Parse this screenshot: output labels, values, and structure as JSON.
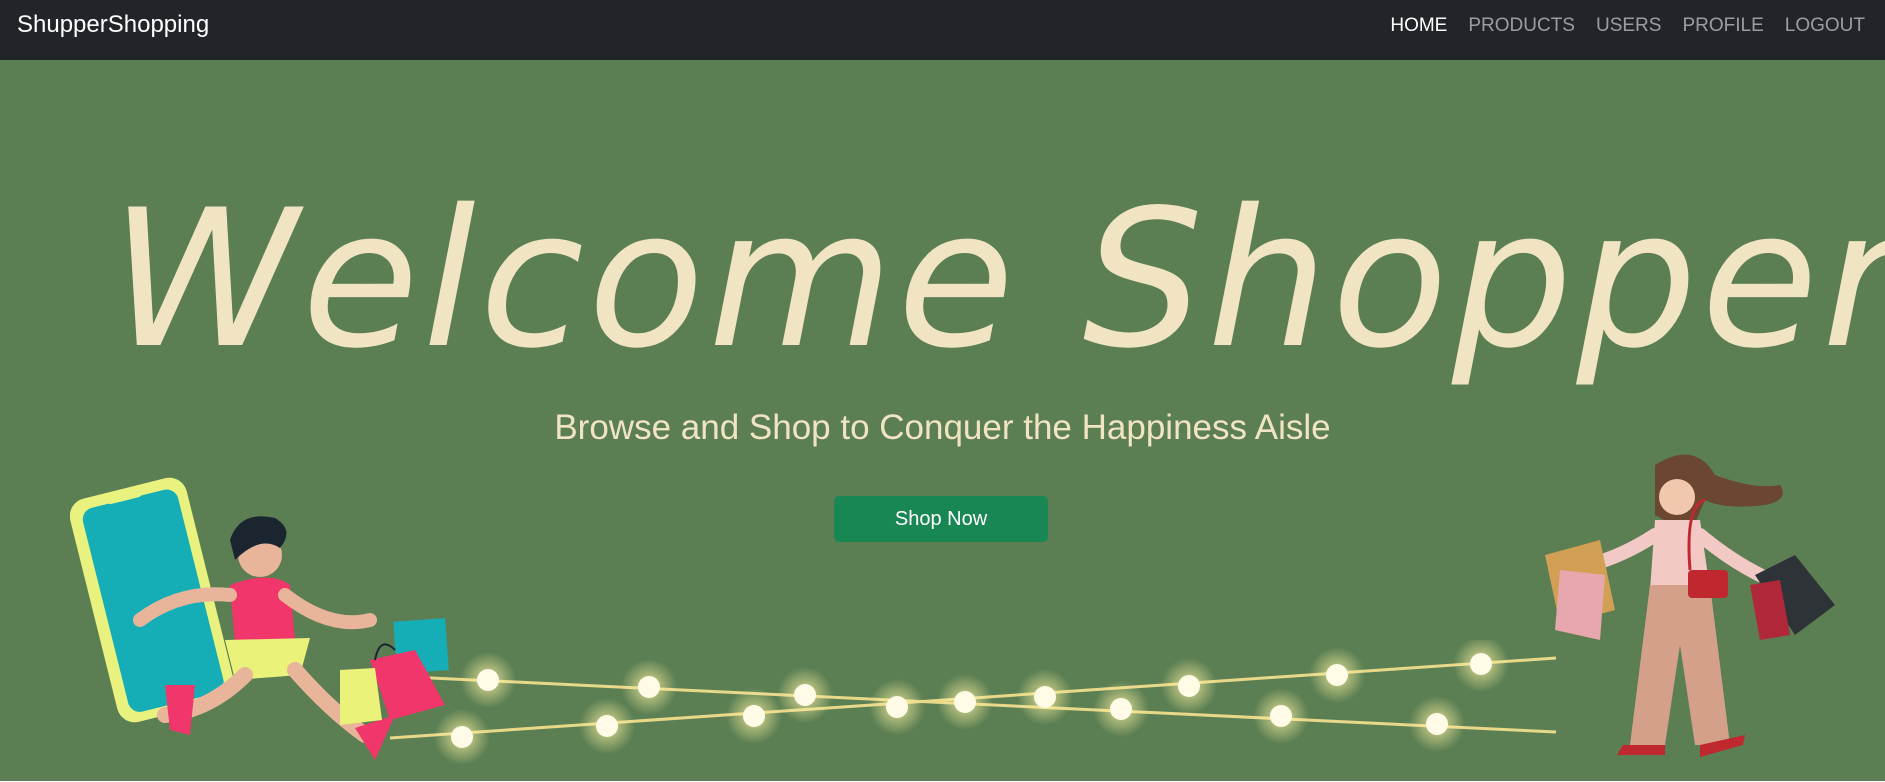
{
  "brand": "ShupperShopping",
  "nav": {
    "home": "HOME",
    "products": "PRODUCTS",
    "users": "USERS",
    "profile": "PROFILE",
    "logout": "LOGOUT"
  },
  "hero": {
    "title": "Welcome Shoppers",
    "subtitle": "Browse and Shop to Conquer the Happiness Aisle",
    "cta": "Shop Now"
  },
  "colors": {
    "navbar": "#212529",
    "hero_bg": "#5b7f53",
    "accent_text": "#f1e4c3",
    "button": "#198754"
  }
}
